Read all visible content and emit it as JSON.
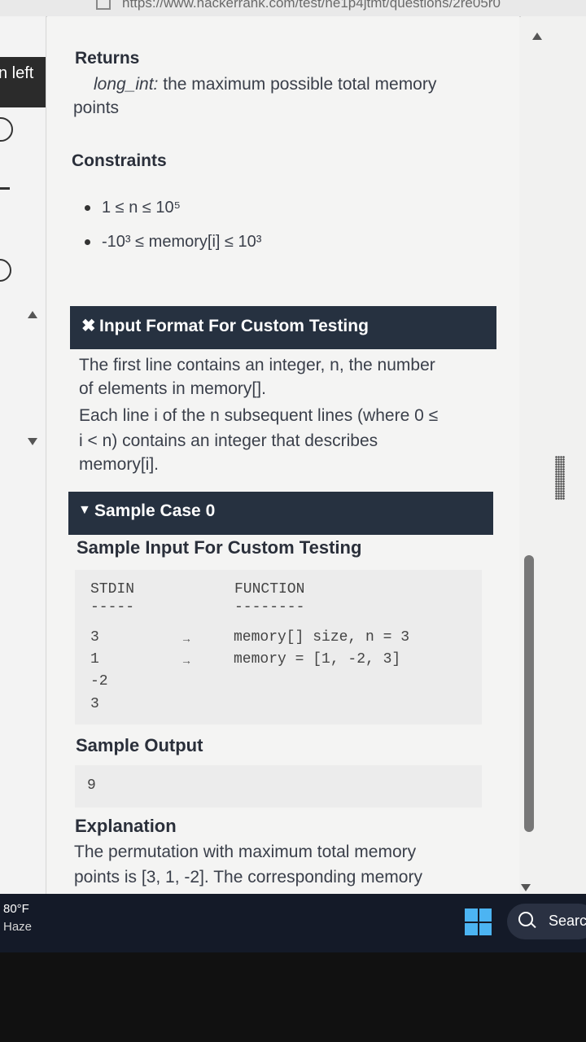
{
  "browser": {
    "url": "https://www.hackerrank.com/test/ne1p4jtmt/questions/2re05r0"
  },
  "sidebar": {
    "time_left_label": "n left"
  },
  "returns": {
    "heading": "Returns",
    "type": "long_int:",
    "description": " the maximum possible total memory",
    "description_cont": "points"
  },
  "constraints": {
    "heading": "Constraints",
    "items": [
      "1 ≤ n ≤ 10⁵",
      "-10³ ≤ memory[i] ≤ 10³"
    ]
  },
  "input_format": {
    "heading": "Input Format For Custom Testing",
    "lines": [
      "The first line contains an integer, n, the number",
      "of elements in memory[].",
      "Each line i of the n subsequent lines (where 0 ≤",
      "i < n) contains an integer that describes",
      "memory[i]."
    ]
  },
  "sample_case": {
    "heading": "Sample Case 0",
    "input_heading": "Sample Input For Custom Testing",
    "stdin_header": "STDIN",
    "function_header": "FUNCTION",
    "stdin_dashes": "-----",
    "function_dashes": "--------",
    "stdin_values": [
      "3",
      "1",
      "-2",
      "3"
    ],
    "function_lines": [
      "memory[] size, n = 3",
      "memory = [1, -2, 3]"
    ],
    "arrow": "→",
    "output_heading": "Sample Output",
    "output_value": "9",
    "explanation_heading": "Explanation",
    "explanation_lines": [
      "The permutation with maximum total memory",
      "points is [3, 1, -2]. The corresponding memory"
    ]
  },
  "taskbar": {
    "temperature": "80°F",
    "weather": "Haze",
    "search_label": "Searc"
  }
}
